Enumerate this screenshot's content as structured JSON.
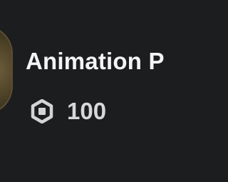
{
  "item": {
    "name": "Animation P",
    "price": "100",
    "currency_icon": "robux-icon"
  },
  "colors": {
    "background": "#1c1d1f",
    "title_text": "#f4f4f4",
    "price_text": "#d8d8d8"
  }
}
